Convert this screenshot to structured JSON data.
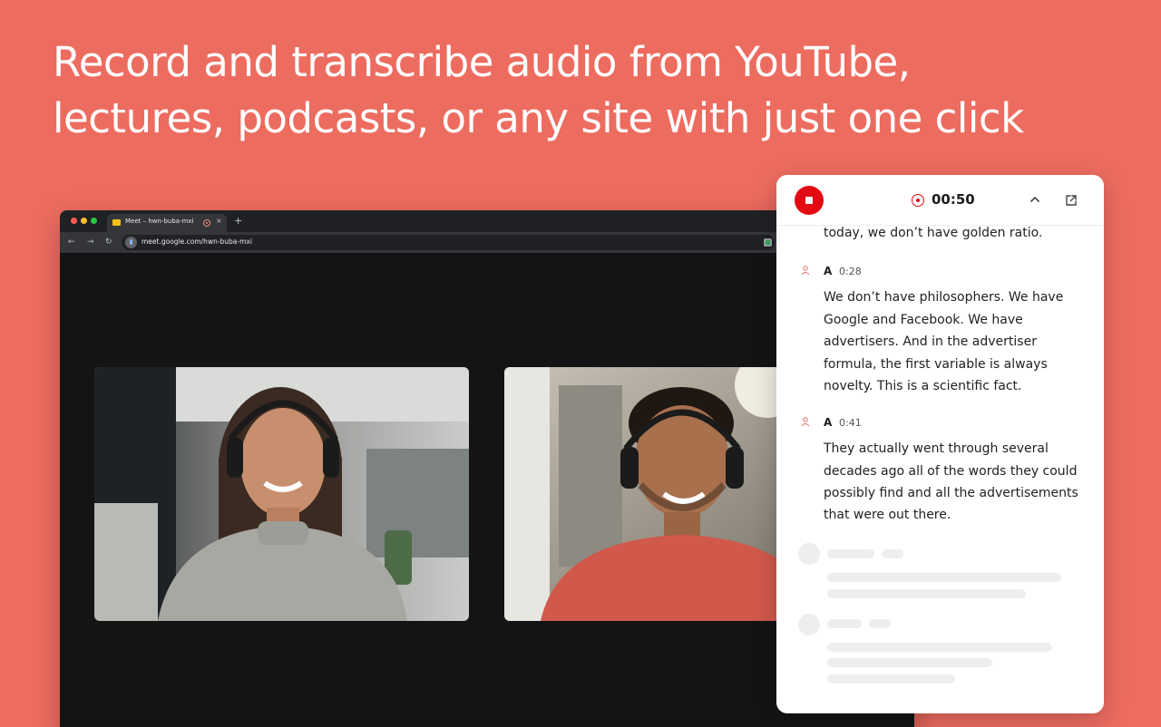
{
  "headline": {
    "line1": "Record and transcribe audio from YouTube,",
    "line2": "lectures, podcasts, or any site with just one click"
  },
  "browser": {
    "tab_title": "Meet – hwn-buba-mxi",
    "tab_close": "×",
    "new_tab": "+",
    "nav_back": "←",
    "nav_forward": "→",
    "nav_reload": "↻",
    "url": "meet.google.com/hwn-buba-mxi",
    "traffic_lights": [
      "#ff5f57",
      "#febc2e",
      "#28c840"
    ]
  },
  "recorder": {
    "timer": "00:50",
    "accent": "#e30b13",
    "transcript": {
      "intro_line": "today, we don’t have golden ratio.",
      "entries": [
        {
          "speaker": "A",
          "time": "0:28",
          "lines": [
            "We don’t have philosophers. We have",
            "Google and Facebook. We have",
            "advertisers. And in the advertiser",
            "formula, the first variable is always",
            "novelty. This is a scientific fact."
          ]
        },
        {
          "speaker": "A",
          "time": "0:41",
          "lines": [
            "They actually went through several",
            "decades ago all of the words they could",
            "possibly find and all the advertisements",
            "that were out there."
          ]
        }
      ]
    }
  },
  "icons": {
    "stop": "stop-icon",
    "record": "record-indicator-icon",
    "collapse": "chevron-up-icon",
    "popout": "external-link-icon",
    "speaker": "user-icon"
  },
  "colors": {
    "background": "#ed6c60",
    "browser_chrome": "#202124",
    "stage": "#141414"
  }
}
